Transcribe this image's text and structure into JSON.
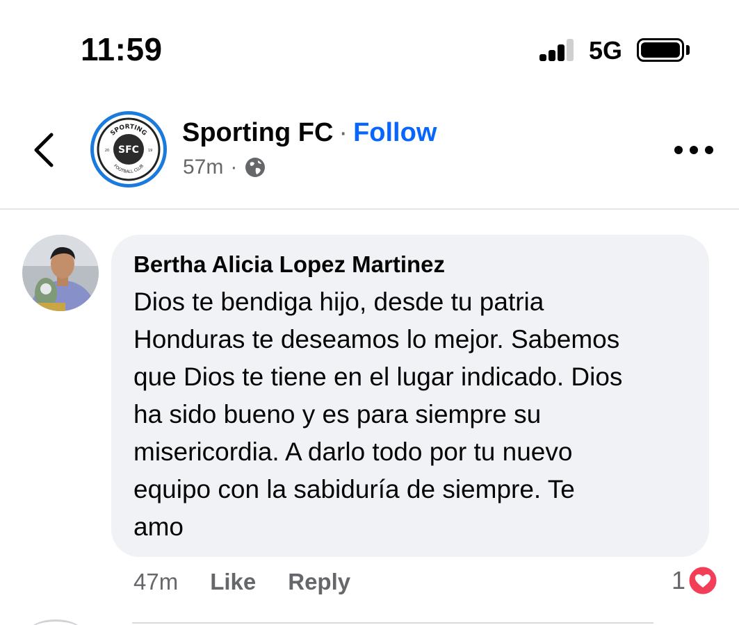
{
  "status_bar": {
    "time": "11:59",
    "network": "5G",
    "icons": [
      "signal-icon",
      "battery-icon"
    ]
  },
  "post_header": {
    "page_name": "Sporting FC",
    "separator": "·",
    "follow_label": "Follow",
    "time": "57m",
    "meta_separator": "·",
    "icons": [
      "back-arrow-icon",
      "globe-icon",
      "more-options-icon"
    ],
    "logo": {
      "arc_text": "SPORTING",
      "bottom_text": "FOOTBALL CLUB",
      "monogram": "SFC",
      "year_left": "20",
      "year_right": "19"
    },
    "accent_color": "#0866ff"
  },
  "comment": {
    "author": "Bertha Alicia Lopez Martinez",
    "lines": [
      "Dios te bendiga hijo, desde tu patria",
      "Honduras te deseamos lo mejor. Sabemos",
      "que Dios te tiene en el lugar indicado. Dios",
      "ha sido bueno y es para siempre su",
      "misericordia. A darlo todo por tu nuevo",
      "equipo con la sabiduría de siempre. Te",
      "amo"
    ],
    "time": "47m",
    "like_label": "Like",
    "reply_label": "Reply",
    "reaction_count": "1",
    "reaction_icon": "heart-icon",
    "bubble_color": "#f0f2f5"
  }
}
